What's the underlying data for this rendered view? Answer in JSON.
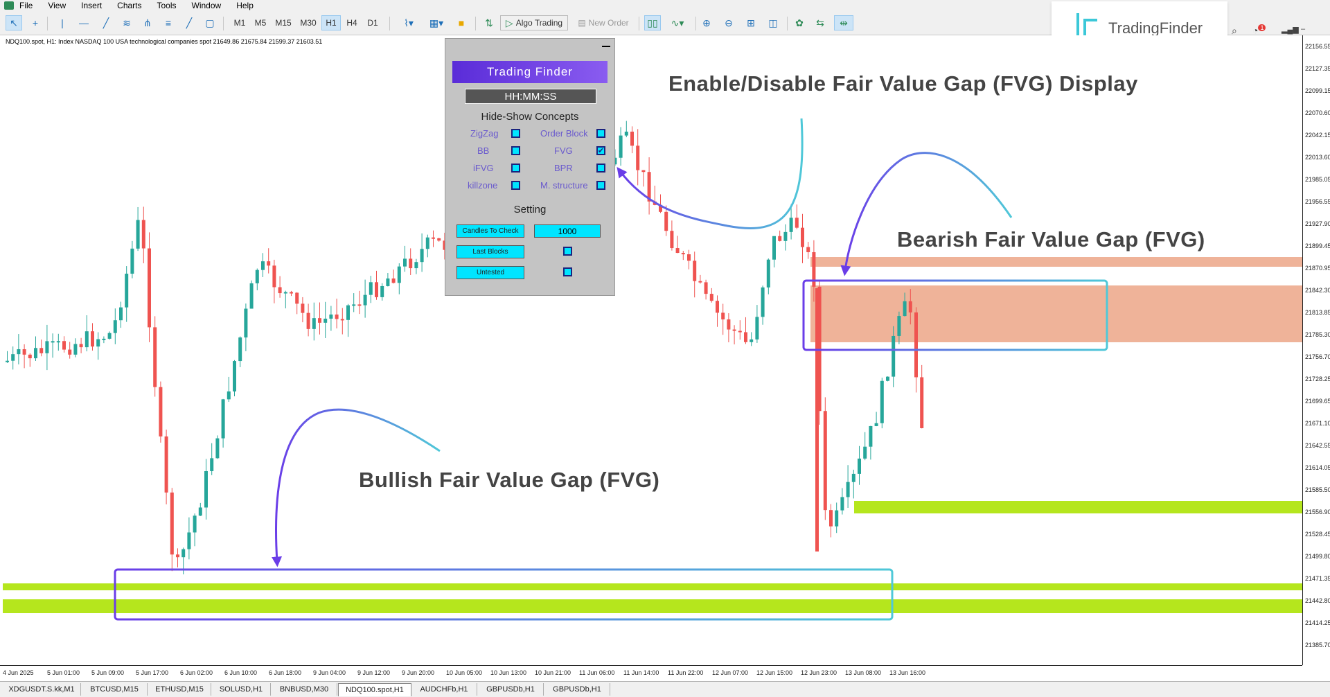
{
  "menu": {
    "items": [
      "File",
      "View",
      "Insert",
      "Charts",
      "Tools",
      "Window",
      "Help"
    ]
  },
  "toolbar": {
    "timeframes": [
      "M1",
      "M5",
      "M15",
      "M30",
      "H1",
      "H4",
      "D1"
    ],
    "active_timeframe": "H1",
    "algo_label": "Algo Trading",
    "new_order_label": "New Order"
  },
  "brand": {
    "name": "TradingFinder",
    "notification_count": "1"
  },
  "chart": {
    "title": "NDQ100.spot, H1:  Index NASDAQ 100 USA technological companies spot  21649.86 21675.84 21599.37 21603.51",
    "price_labels": [
      "22156.55",
      "22127.35",
      "22099.15",
      "22070.60",
      "22042.15",
      "22013.60",
      "21985.05",
      "21956.55",
      "21927.90",
      "21899.45",
      "21870.95",
      "21842.30",
      "21813.85",
      "21785.30",
      "21756.70",
      "21728.25",
      "21699.65",
      "21671.10",
      "21642.55",
      "21614.05",
      "21585.50",
      "21556.90",
      "21528.45",
      "21499.80",
      "21471.35",
      "21442.80",
      "21414.25",
      "21385.70"
    ],
    "time_labels": [
      "4 Jun 2025",
      "5 Jun 01:00",
      "5 Jun 09:00",
      "5 Jun 17:00",
      "6 Jun 02:00",
      "6 Jun 10:00",
      "6 Jun 18:00",
      "9 Jun 04:00",
      "9 Jun 12:00",
      "9 Jun 20:00",
      "10 Jun 05:00",
      "10 Jun 13:00",
      "10 Jun 21:00",
      "11 Jun 06:00",
      "11 Jun 14:00",
      "11 Jun 22:00",
      "12 Jun 07:00",
      "12 Jun 15:00",
      "12 Jun 23:00",
      "13 Jun 08:00",
      "13 Jun 16:00"
    ]
  },
  "panel": {
    "clock": "HH:MM:SS",
    "logo_text": "Trading Finder",
    "concepts_title": "Hide-Show Concepts",
    "concepts": [
      {
        "label": "ZigZag",
        "checked": false
      },
      {
        "label": "Order Block",
        "checked": false
      },
      {
        "label": "BB",
        "checked": false
      },
      {
        "label": "FVG",
        "checked": true
      },
      {
        "label": "iFVG",
        "checked": false
      },
      {
        "label": "BPR",
        "checked": false
      },
      {
        "label": "killzone",
        "checked": false
      },
      {
        "label": "M. structure",
        "checked": false
      }
    ],
    "setting_title": "Setting",
    "candles_label": "Candles To Check",
    "candles_value": "1000",
    "last_blocks_label": "Last Blocks",
    "untested_label": "Untested"
  },
  "annotations": {
    "enable": "Enable/Disable Fair Value Gap (FVG) Display",
    "bearish": "Bearish Fair Value Gap (FVG)",
    "bullish": "Bullish Fair Value Gap (FVG)"
  },
  "tabs": [
    "XDGUSDT.S.kk,M1",
    "BTCUSD,M15",
    "ETHUSD,M15",
    "SOLUSD,H1",
    "BNBUSD,M30",
    "NDQ100.spot,H1",
    "AUDCHFb,H1",
    "GBPUSDb,H1",
    "GBPUSDb,H1"
  ],
  "active_tab": "NDQ100.spot,H1",
  "colors": {
    "bull": "#26a69a",
    "bear": "#ef5350",
    "bearish_zone": "#efb399",
    "bullish_zone": "#b5e61d",
    "panel_bg": "#c4c4c4",
    "accent": "#7b3fe4",
    "cyan": "#4fc8d8"
  }
}
